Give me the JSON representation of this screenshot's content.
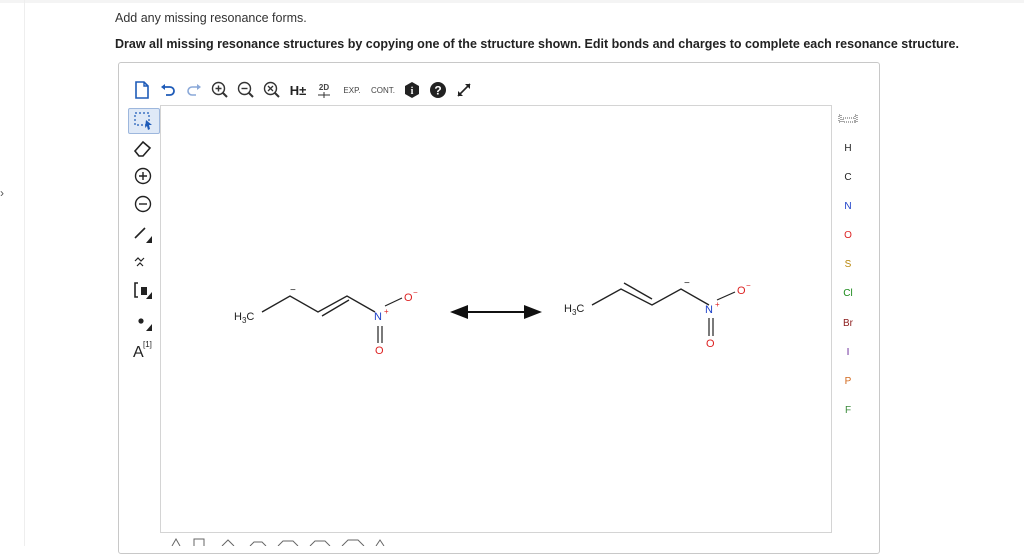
{
  "question": {
    "line1": "Add any missing resonance forms.",
    "line2": "Draw all missing resonance structures by copying one of the structure shown. Edit bonds and charges to complete each resonance structure."
  },
  "toolbar": {
    "items": [
      "new-doc",
      "undo",
      "redo",
      "zoom-in",
      "zoom-out",
      "zoom-reset",
      "explicit-h",
      "clean-2d",
      "expand",
      "contract",
      "info",
      "help",
      "fullscreen"
    ],
    "h_label": "H±",
    "clean_label": "2D",
    "exp_label": "EXP.",
    "cont_label": "CONT."
  },
  "left_tools": {
    "items": [
      "select-lasso",
      "eraser",
      "plus-charge",
      "minus-charge",
      "single-bond",
      "chain",
      "template-bracket",
      "radical-dot",
      "atom-label"
    ],
    "bracket_label": "[1]",
    "atom_label": "A"
  },
  "elements": {
    "items": [
      "H",
      "C",
      "N",
      "O",
      "S",
      "Cl",
      "Br",
      "I",
      "P",
      "F"
    ],
    "colors": {
      "N": "#1a3ec8",
      "O": "#d22222",
      "S": "#b8860b",
      "Cl": "#1a8a1a",
      "Br": "#8b1a1a",
      "I": "#6a2a9a",
      "P": "#d2691e",
      "F": "#3a8a3a"
    }
  },
  "structures": {
    "left": {
      "methyl": "H₃C",
      "minus_top": "−",
      "nitrogen": "N",
      "n_charge": "+",
      "oxygen_minus": "O",
      "o_charge": "−",
      "oxygen_double": "O"
    },
    "right": {
      "methyl": "H₃C",
      "minus_top": "−",
      "nitrogen": "N",
      "n_charge": "+",
      "oxygen_minus": "O",
      "o_charge": "−",
      "oxygen_double": "O"
    }
  },
  "colors": {
    "nitrogen": "#1a3ec8",
    "oxygen": "#d22222",
    "bond": "#222222",
    "selected_bg": "#dfe9f7"
  }
}
